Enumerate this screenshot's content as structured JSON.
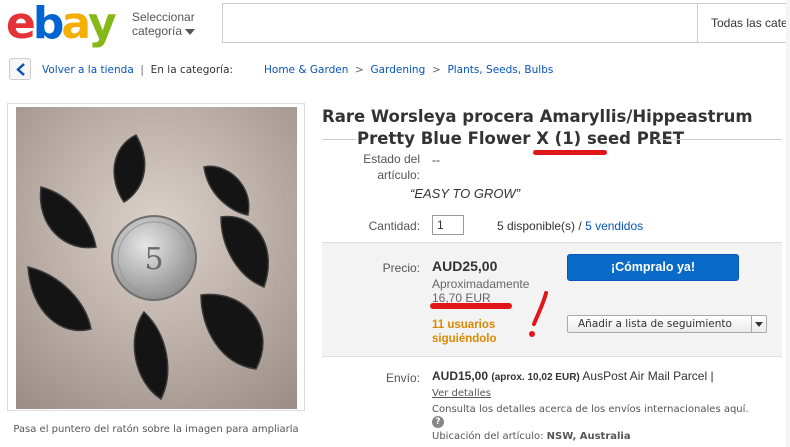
{
  "header": {
    "logo": [
      "e",
      "b",
      "a",
      "y"
    ],
    "logo_colors": [
      "#e53238",
      "#0064d2",
      "#f5af02",
      "#86b817"
    ],
    "category_line1": "Seleccionar",
    "category_line2": "categoría",
    "search_value": "",
    "search_category": "Todas las categorías"
  },
  "breadcrumb": {
    "back": "Volver a la tienda",
    "in_category": "En la categoría:",
    "items": [
      "Home & Garden",
      "Gardening",
      "Plants, Seeds, Bulbs"
    ]
  },
  "image": {
    "caption": "Pasa el puntero del ratón sobre la imagen para ampliarla"
  },
  "listing": {
    "title_line1": "Rare Worsleya procera Amaryllis/Hippeastrum",
    "title_line2": "Pretty Blue Flower X (1) seed PRET",
    "condition_label": "Estado del artículo:",
    "condition_value": "--",
    "tagline": "“EASY TO GROW”",
    "quantity_label": "Cantidad:",
    "quantity_value": "1",
    "available": "5 disponible(s)",
    "divider": "/",
    "sold": "5 vendidos"
  },
  "price": {
    "label": "Precio:",
    "value": "AUD25,00",
    "approx_label": "Aproximadamente",
    "approx_value": "16,70 EUR",
    "watchers_line1": "11 usuarios",
    "watchers_line2": "siguiéndolo",
    "buy_button": "¡Cómpralo ya!",
    "watch_button": "Añadir a lista de seguimiento"
  },
  "shipping": {
    "label": "Envío:",
    "value": "AUD15,00",
    "approx": "(aprox. 10,02 EUR)",
    "service": "AusPost Air Mail Parcel |",
    "details_link": "Ver detalles",
    "intl_note": "Consulta los detalles acerca de los envíos internacionales aquí.",
    "location_label": "Ubicación del artículo:",
    "location_value": "NSW, Australia"
  },
  "colors": {
    "link": "#0654ba",
    "buy_button": "#0a6ac7",
    "watchers": "#dd8800",
    "annotation": "#e0161b"
  }
}
